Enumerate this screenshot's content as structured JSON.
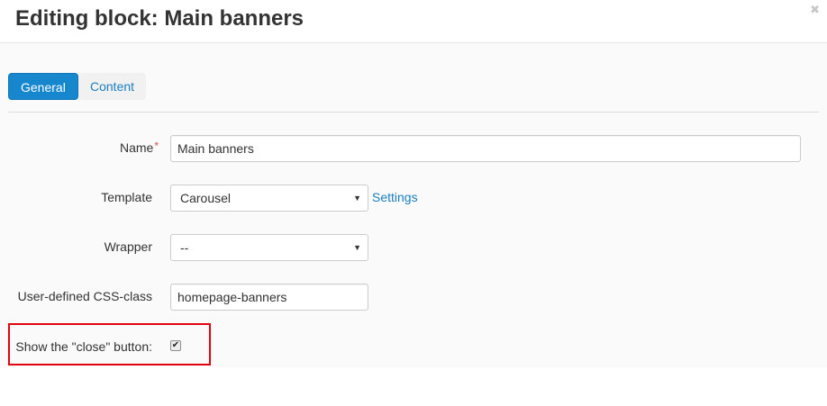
{
  "dialog": {
    "title": "Editing block: Main banners",
    "close_glyph": "✖"
  },
  "tabs": [
    {
      "label": "General",
      "active": true
    },
    {
      "label": "Content",
      "active": false
    }
  ],
  "form": {
    "name": {
      "label": "Name",
      "required_marker": "*",
      "value": "Main banners"
    },
    "template": {
      "label": "Template",
      "value": "Carousel",
      "settings_link": "Settings"
    },
    "wrapper": {
      "label": "Wrapper",
      "value": "--"
    },
    "css_class": {
      "label": "User-defined CSS-class",
      "value": "homepage-banners"
    },
    "show_close": {
      "label": "Show the \"close\" button:",
      "checked": true,
      "check_glyph": "✔"
    }
  },
  "icons": {
    "dropdown_arrow": "▼"
  },
  "colors": {
    "accent": "#1686cd",
    "link": "#1a7fc1",
    "required": "#d9534f",
    "highlight_border": "#e3000f"
  }
}
